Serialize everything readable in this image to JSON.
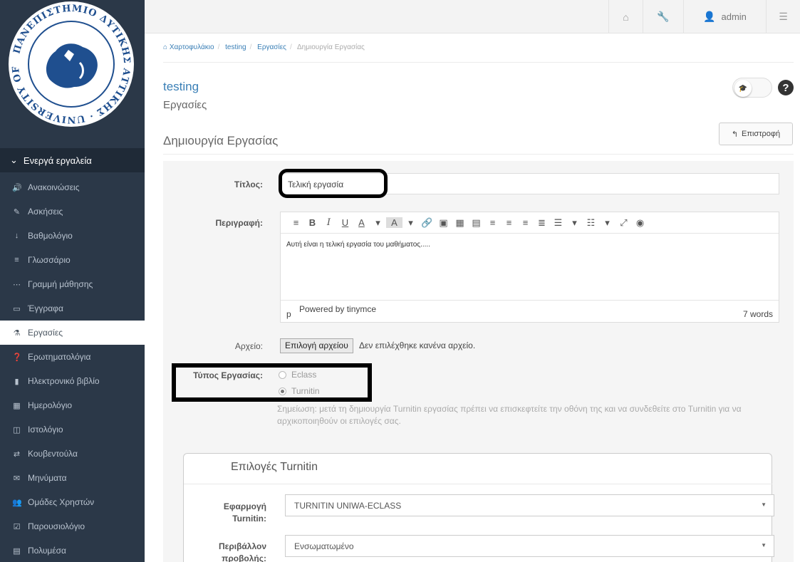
{
  "topbar": {
    "user": "admin"
  },
  "sidebar": {
    "section_title": "Ενεργά εργαλεία",
    "items": [
      {
        "label": "Ανακοινώσεις",
        "icon": "🔊"
      },
      {
        "label": "Ασκήσεις",
        "icon": "✎"
      },
      {
        "label": "Βαθμολόγιο",
        "icon": "↓"
      },
      {
        "label": "Γλωσσάριο",
        "icon": "≡"
      },
      {
        "label": "Γραμμή μάθησης",
        "icon": "⋯"
      },
      {
        "label": "Έγγραφα",
        "icon": "▭"
      },
      {
        "label": "Εργασίες",
        "icon": "⚗"
      },
      {
        "label": "Ερωτηματολόγια",
        "icon": "❓"
      },
      {
        "label": "Ηλεκτρονικό βιβλίο",
        "icon": "▮"
      },
      {
        "label": "Ημερολόγιο",
        "icon": "▦"
      },
      {
        "label": "Ιστολόγιο",
        "icon": "◫"
      },
      {
        "label": "Κουβεντούλα",
        "icon": "⇄"
      },
      {
        "label": "Μηνύματα",
        "icon": "✉"
      },
      {
        "label": "Ομάδες Χρηστών",
        "icon": "👥"
      },
      {
        "label": "Παρουσιολόγιο",
        "icon": "☑"
      },
      {
        "label": "Πολυμέσα",
        "icon": "▤"
      }
    ],
    "active_index": 6
  },
  "breadcrumb": [
    "Χαρτοφυλάκιο",
    "testing",
    "Εργασίες",
    "Δημιουργία Εργασίας"
  ],
  "header": {
    "course_title": "testing",
    "module_title": "Εργασίες",
    "page_heading": "Δημιουργία Εργασίας",
    "back_label": "Επιστροφή"
  },
  "form": {
    "title_label": "Τίτλος:",
    "title_value": "Τελική εργασία",
    "description_label": "Περιγραφή:",
    "description_text": "Αυτή είναι η τελική εργασία του μαθήματος.....",
    "editor_path": "p",
    "editor_powered": "Powered by tinymce",
    "editor_wordcount": "7 words",
    "file_label": "Αρχείο:",
    "file_button": "Επιλογή αρχείου",
    "file_status": "Δεν επιλέχθηκε κανένα αρχείο.",
    "type_label": "Τύπος Εργασίας:",
    "type_options": [
      "Eclass",
      "Turnitin"
    ],
    "type_selected": "Turnitin",
    "type_note": "Σημείωση: μετά τη δημιουργία Turnitin εργασίας πρέπει να επισκεφτείτε την οθόνη της και να συνδεθείτε στο Turnitin για να αρχικοποιηθούν οι επιλογές σας."
  },
  "turnitin": {
    "title": "Επιλογές Turnitin",
    "app_label_1": "Εφαρμογή",
    "app_label_2": "Turnitin:",
    "app_value": "TURNITIN UNIWA-ECLASS",
    "env_label_1": "Περιβάλλον",
    "env_label_2": "προβολής:",
    "env_value": "Ενσωματωμένο"
  },
  "logo": {
    "ring_text": "ΠΑΝΕΠΙΣΤΗΜΙΟ ΔΥΤΙΚΗΣ ΑΤΤΙΚΗΣ · UNIVERSITY OF WEST ATTICA",
    "color": "#1f4f8f"
  }
}
